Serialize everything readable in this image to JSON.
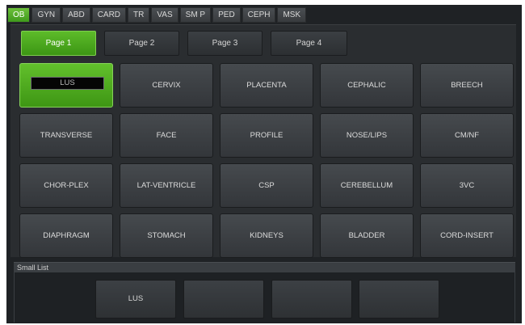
{
  "category_tabs": [
    "OB",
    "GYN",
    "ABD",
    "CARD",
    "TR",
    "VAS",
    "SM P",
    "PED",
    "CEPH",
    "MSK"
  ],
  "active_category": "OB",
  "pages": [
    "Page 1",
    "Page 2",
    "Page 3",
    "Page 4"
  ],
  "active_page": "Page 1",
  "presets": {
    "row1": [
      "LUS",
      "CERVIX",
      "PLACENTA",
      "CEPHALIC",
      "BREECH"
    ],
    "row2": [
      "TRANSVERSE",
      "FACE",
      "PROFILE",
      "NOSE/LIPS",
      "CM/NF"
    ],
    "row3": [
      "CHOR-PLEX",
      "LAT-VENTRICLE",
      "CSP",
      "CEREBELLUM",
      "3VC"
    ],
    "row4": [
      "DIAPHRAGM",
      "STOMACH",
      "KIDNEYS",
      "BLADDER",
      "CORD-INSERT"
    ]
  },
  "active_preset": "LUS",
  "small_list": {
    "title": "Small List",
    "items": [
      "LUS",
      "",
      "",
      ""
    ]
  },
  "colors": {
    "accent_green": "#4fae20",
    "panel_bg": "#2a2d30",
    "button_bg": "#3f4347"
  }
}
